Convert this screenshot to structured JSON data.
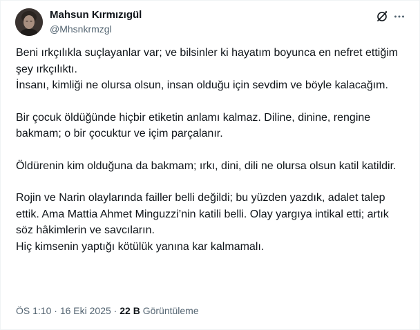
{
  "author": {
    "name": "Mahsun Kırmızıgül",
    "handle": "@Mhsnkrmzgl"
  },
  "icons": {
    "grok": "grok-icon",
    "more": "more-icon"
  },
  "tweet": {
    "para1_line1": "Beni ırkçılıkla suçlayanlar var; ve bilsinler ki hayatım boyunca en nefret ettiğim şey ırkçılıktı.",
    "para1_line2": "İnsanı, kimliği ne olursa olsun, insan olduğu için sevdim ve böyle kalacağım.",
    "para2": "Bir çocuk öldüğünde hiçbir etiketin anlamı kalmaz. Diline, dinine, rengine bakmam; o bir çocuktur ve içim parçalanır.",
    "para3": "Öldürenin kim olduğuna da bakmam; ırkı, dini, dili ne olursa olsun katil katildir.",
    "para4_line1": "Rojin ve Narin olaylarında failler belli değildi; bu yüzden yazdık, adalet talep ettik. Ama Mattia Ahmet Minguzzi’nin katili belli. Olay yargıya intikal etti; artık söz hâkimlerin ve savcıların.",
    "para4_line2": "Hiç kimsenin yaptığı kötülük yanına kar kalmamalı."
  },
  "meta": {
    "time": "ÖS 1:10",
    "separator1": "·",
    "date": "16 Eki 2025",
    "separator2": "·",
    "views_count": "22 B",
    "views_label": "Görüntüleme"
  },
  "colors": {
    "text": "#0f1419",
    "secondary": "#536471",
    "border": "#eff3f4"
  }
}
